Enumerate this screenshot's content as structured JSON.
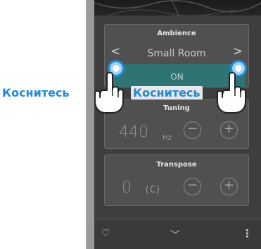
{
  "ambience": {
    "title": "Ambience",
    "value": "Small Room",
    "prev_glyph": "<",
    "next_glyph": ">",
    "toggle_label": "ON"
  },
  "tuning": {
    "title": "Tuning",
    "value": "440",
    "unit": "Hz",
    "minus": "−",
    "plus": "+"
  },
  "transpose": {
    "title": "Transpose",
    "value": "0",
    "key": "(C)",
    "minus": "−",
    "plus": "+"
  },
  "bottom_bar": {
    "heart_icon": "♡",
    "chevron_icon": "﹀",
    "menu_icon": "⋮"
  },
  "callouts": {
    "left": "Коснитесь",
    "right": "Коснитесь"
  },
  "colors": {
    "accent": "#1f8ad9",
    "toggle_on": "#2f7473",
    "panel_bg": "#505050",
    "screen_bg": "#3e3e3e"
  }
}
